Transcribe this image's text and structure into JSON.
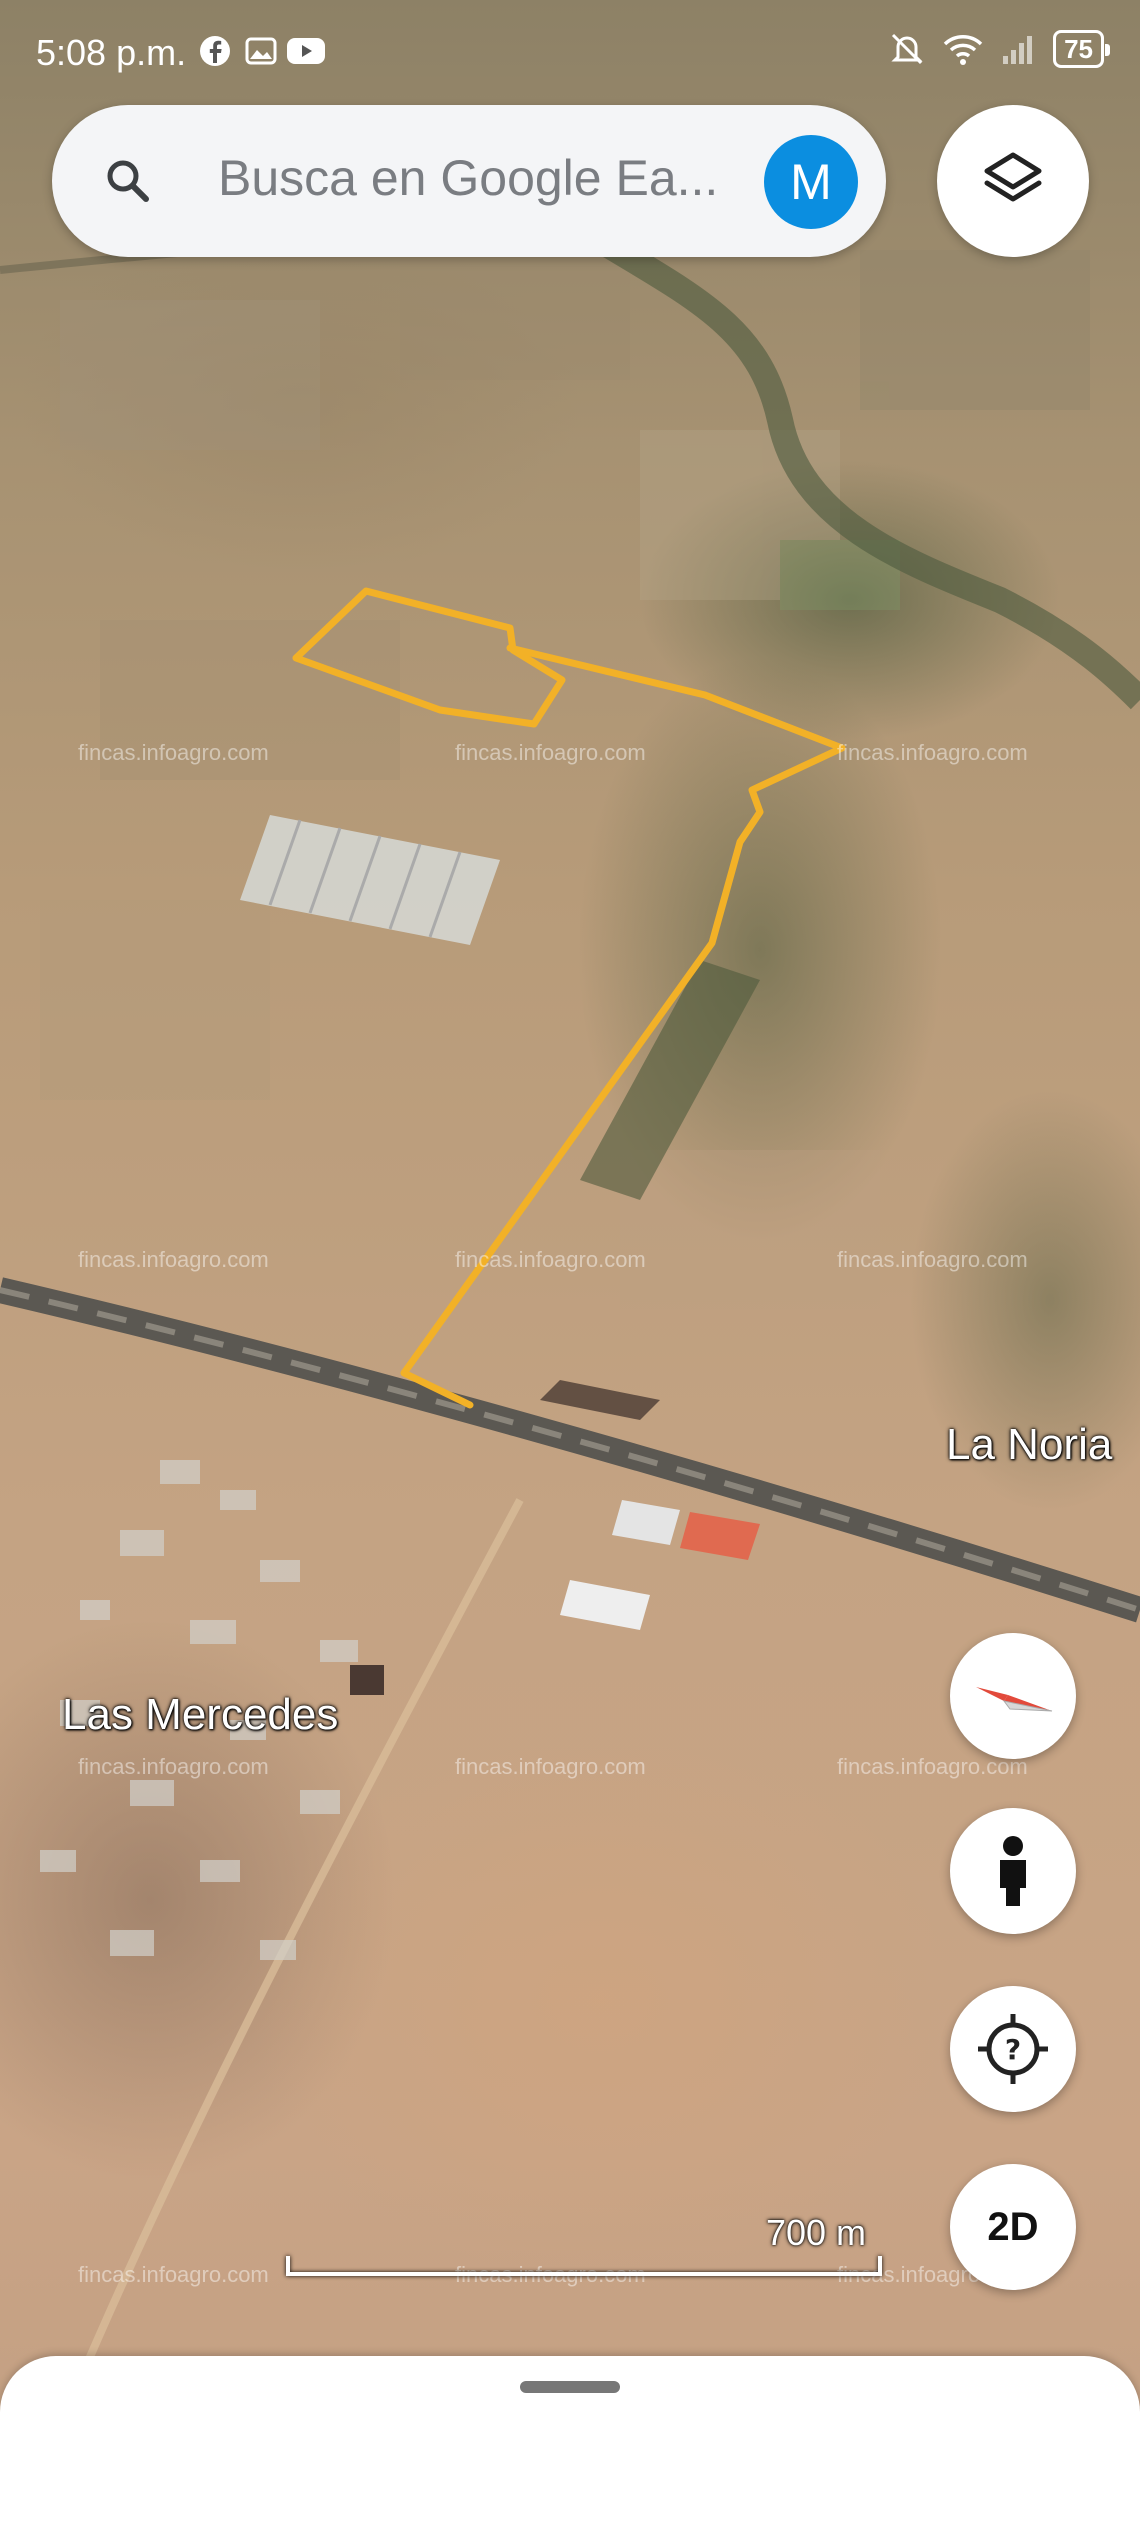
{
  "status_bar": {
    "time": "5:08 p.m.",
    "battery": "75"
  },
  "search": {
    "placeholder": "Busca en Google Ea...",
    "avatar_letter": "M"
  },
  "map": {
    "labels": {
      "la_noria": "La Noria",
      "las_mercedes": "Las Mercedes"
    },
    "watermark": "fincas.infoagro.com",
    "scale_label": "700 m",
    "boundary_color": "#f2b127"
  },
  "controls": {
    "view_mode_label": "2D",
    "icons": [
      "search-icon",
      "layers-icon",
      "compass-icon",
      "street-view-icon",
      "my-location-icon"
    ]
  }
}
